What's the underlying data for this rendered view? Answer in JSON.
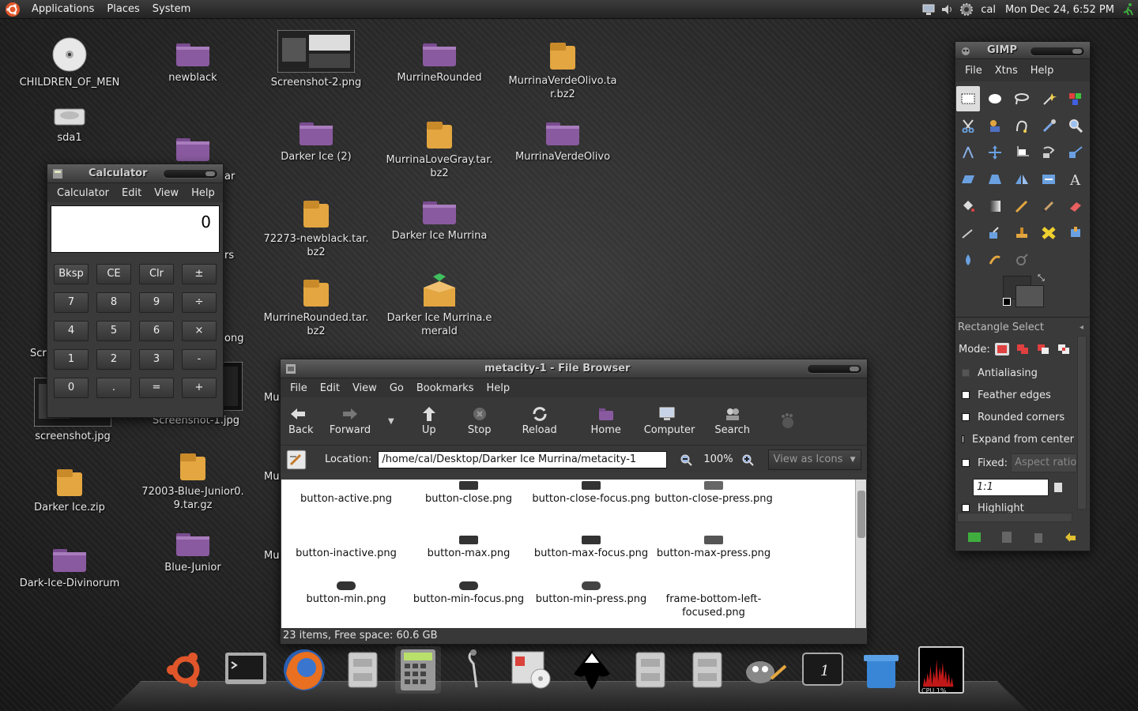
{
  "top_panel": {
    "menus": [
      "Applications",
      "Places",
      "System"
    ],
    "user": "cal",
    "clock": "Mon Dec 24,  6:52 PM"
  },
  "desktop_icons": [
    {
      "label": "CHILDREN_OF_MEN",
      "icon": "cd-icon"
    },
    {
      "label": "newblack",
      "icon": "folder-icon"
    },
    {
      "label": "Screenshot-2.png",
      "icon": "image-icon"
    },
    {
      "label": "MurrineRounded",
      "icon": "folder-icon"
    },
    {
      "label": "MurrinaVerdeOlivo.tar.bz2",
      "icon": "archive-icon"
    },
    {
      "label": "sda1",
      "icon": "drive-icon"
    },
    {
      "label": "Darker Ice (2)",
      "icon": "folder-icon"
    },
    {
      "label": "MurrinaLoveGray.tar.bz2",
      "icon": "archive-icon"
    },
    {
      "label": "MurrinaVerdeOlivo",
      "icon": "folder-icon"
    },
    {
      "label": "72273-newblack.tar.bz2",
      "icon": "archive-icon"
    },
    {
      "label": "Darker Ice Murrina",
      "icon": "folder-icon"
    },
    {
      "label": "MurrineRounded.tar.bz2",
      "icon": "archive-icon"
    },
    {
      "label": "Darker Ice Murrina.emerald",
      "icon": "package-icon"
    },
    {
      "label": "screenshot.jpg",
      "icon": "image-icon"
    },
    {
      "label": "Screenshot-1.jpg",
      "icon": "image-icon"
    },
    {
      "label": "Darker Ice.zip",
      "icon": "archive-icon"
    },
    {
      "label": "72003-Blue-Junior0.9.tar.gz",
      "icon": "archive-icon"
    },
    {
      "label": "Dark-Ice-Divinorum",
      "icon": "folder-icon"
    },
    {
      "label": "Blue-Junior",
      "icon": "folder-icon"
    }
  ],
  "calculator": {
    "title": "Calculator",
    "menus": [
      "Calculator",
      "Edit",
      "View",
      "Help"
    ],
    "display": "0",
    "keys": [
      "Bksp",
      "CE",
      "Clr",
      "±",
      "7",
      "8",
      "9",
      "÷",
      "4",
      "5",
      "6",
      "×",
      "1",
      "2",
      "3",
      "-",
      "0",
      ".",
      "=",
      "+"
    ]
  },
  "file_browser": {
    "title": "metacity-1 - File Browser",
    "menus": [
      "File",
      "Edit",
      "View",
      "Go",
      "Bookmarks",
      "Help"
    ],
    "toolbar": [
      "Back",
      "Forward",
      "Up",
      "Stop",
      "Reload",
      "Home",
      "Computer",
      "Search"
    ],
    "location_label": "Location:",
    "location": "/home/cal/Desktop/Darker Ice Murrina/metacity-1",
    "zoom": "100%",
    "view_mode": "View as Icons",
    "files": [
      "button-active.png",
      "button-close.png",
      "button-close-focus.png",
      "button-close-press.png",
      "button-inactive.png",
      "button-max.png",
      "button-max-focus.png",
      "button-max-press.png",
      "button-min.png",
      "button-min-focus.png",
      "button-min-press.png",
      "frame-bottom-left-focused.png"
    ],
    "status": "23 items, Free space: 60.6 GB"
  },
  "gimp": {
    "title": "GIMP",
    "menus": [
      "File",
      "Xtns",
      "Help"
    ],
    "panel_title": "Rectangle Select",
    "mode_label": "Mode:",
    "options": [
      "Antialiasing",
      "Feather edges",
      "Rounded corners",
      "Expand from center"
    ],
    "fixed_label": "Fixed:",
    "fixed_value": "Aspect ratio",
    "ratio": "1:1",
    "highlight": "Highlight"
  },
  "dock": {
    "cpu_label": "CPU 1%"
  },
  "colors": {
    "panel": "#2e2e2e",
    "folder": "#8a5aa0",
    "archive": "#e3a640",
    "accent_red": "#d9433b"
  }
}
